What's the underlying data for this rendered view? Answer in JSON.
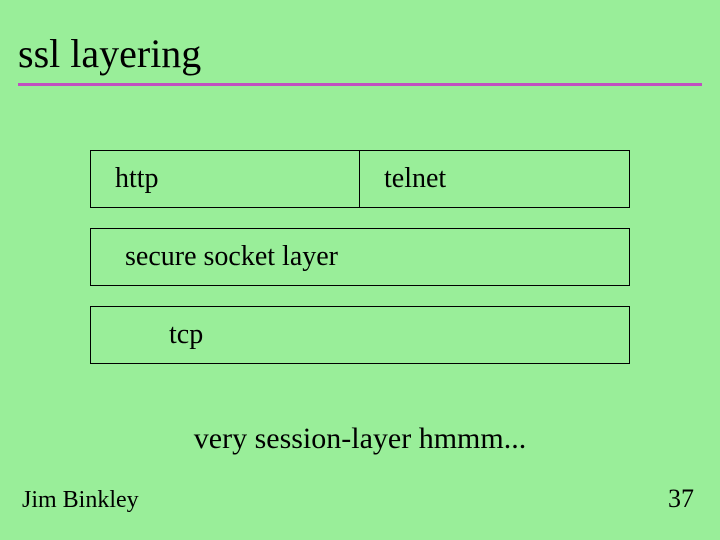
{
  "title": "ssl layering",
  "layers": {
    "top_left": "http",
    "top_right": "telnet",
    "middle": "secure socket layer",
    "bottom": "tcp"
  },
  "caption": "very session-layer hmmm...",
  "author": "Jim Binkley",
  "page_number": "37"
}
